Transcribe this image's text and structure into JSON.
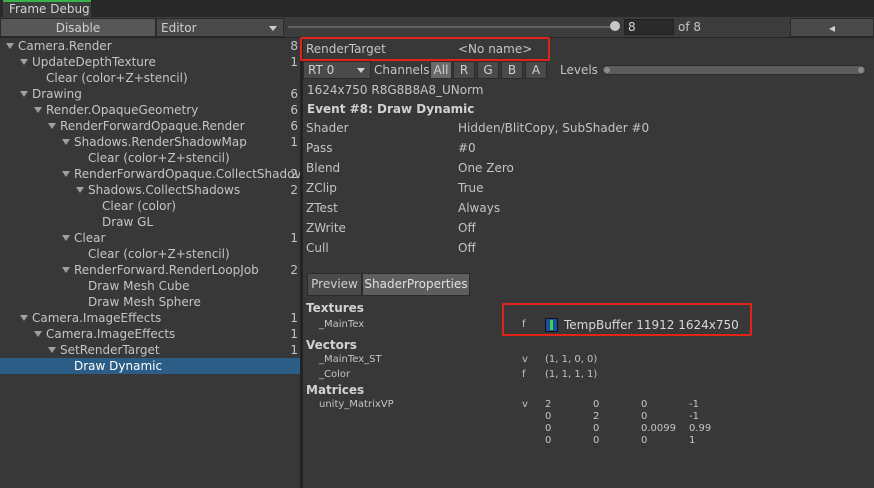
{
  "window": {
    "title": "Frame Debug"
  },
  "toolbar": {
    "disable_label": "Disable",
    "target_dropdown": "Editor",
    "event_index": "8",
    "event_total": "of 8",
    "prev_glyph": "◂"
  },
  "tree": [
    {
      "label": "Camera.Render",
      "count": "8",
      "expanded": true
    },
    {
      "label": "UpdateDepthTexture",
      "count": "1",
      "expanded": true
    },
    {
      "label": "Clear (color+Z+stencil)",
      "count": ""
    },
    {
      "label": "Drawing",
      "count": "6",
      "expanded": true
    },
    {
      "label": "Render.OpaqueGeometry",
      "count": "6",
      "expanded": true
    },
    {
      "label": "RenderForwardOpaque.Render",
      "count": "6",
      "expanded": true
    },
    {
      "label": "Shadows.RenderShadowMap",
      "count": "1",
      "expanded": true
    },
    {
      "label": "Clear (color+Z+stencil)",
      "count": ""
    },
    {
      "label": "RenderForwardOpaque.CollectShadov",
      "count": "2",
      "expanded": true
    },
    {
      "label": "Shadows.CollectShadows",
      "count": "2",
      "expanded": true
    },
    {
      "label": "Clear (color)",
      "count": ""
    },
    {
      "label": "Draw GL",
      "count": ""
    },
    {
      "label": "Clear",
      "count": "1",
      "expanded": true
    },
    {
      "label": "Clear (color+Z+stencil)",
      "count": ""
    },
    {
      "label": "RenderForward.RenderLoopJob",
      "count": "2",
      "expanded": true
    },
    {
      "label": "Draw Mesh Cube",
      "count": ""
    },
    {
      "label": "Draw Mesh Sphere",
      "count": ""
    },
    {
      "label": "Camera.ImageEffects",
      "count": "1",
      "expanded": true
    },
    {
      "label": "Camera.ImageEffects",
      "count": "1",
      "expanded": true
    },
    {
      "label": "SetRenderTarget",
      "count": "1",
      "expanded": true
    },
    {
      "label": "Draw Dynamic",
      "count": "",
      "selected": true
    }
  ],
  "detail": {
    "render_target_label": "RenderTarget",
    "render_target_value": "<No name>",
    "rt_dropdown": "RT 0",
    "channels_label": "Channels",
    "channels": [
      "All",
      "R",
      "G",
      "B",
      "A"
    ],
    "levels_label": "Levels",
    "format": "1624x750 R8G8B8A8_UNorm",
    "event_title": "Event #8: Draw Dynamic",
    "props": [
      {
        "name": "Shader",
        "value": "Hidden/BlitCopy, SubShader #0"
      },
      {
        "name": "Pass",
        "value": "#0"
      },
      {
        "name": "Blend",
        "value": "One Zero"
      },
      {
        "name": "ZClip",
        "value": "True"
      },
      {
        "name": "ZTest",
        "value": "Always"
      },
      {
        "name": "ZWrite",
        "value": "Off"
      },
      {
        "name": "Cull",
        "value": "Off"
      }
    ],
    "tabs": [
      "Preview",
      "ShaderProperties"
    ],
    "textures_header": "Textures",
    "texture": {
      "name": "_MainTex",
      "stage": "f",
      "value": "TempBuffer 11912 1624x750"
    },
    "vectors_header": "Vectors",
    "vectors": [
      {
        "name": "_MainTex_ST",
        "stage": "v",
        "value": "(1, 1, 0, 0)"
      },
      {
        "name": "_Color",
        "stage": "f",
        "value": "(1, 1, 1, 1)"
      }
    ],
    "matrices_header": "Matrices",
    "matrix": {
      "name": "unity_MatrixVP",
      "stage": "v",
      "rows": [
        [
          "2",
          "0",
          "0",
          "-1"
        ],
        [
          "0",
          "2",
          "0",
          "-1"
        ],
        [
          "0",
          "0",
          "0.0099",
          "0.99"
        ],
        [
          "0",
          "0",
          "0",
          "1"
        ]
      ]
    }
  },
  "colors": {
    "selection": "#2c5d87",
    "highlight_box": "#e2231a",
    "active_tab": "#37b24d"
  }
}
